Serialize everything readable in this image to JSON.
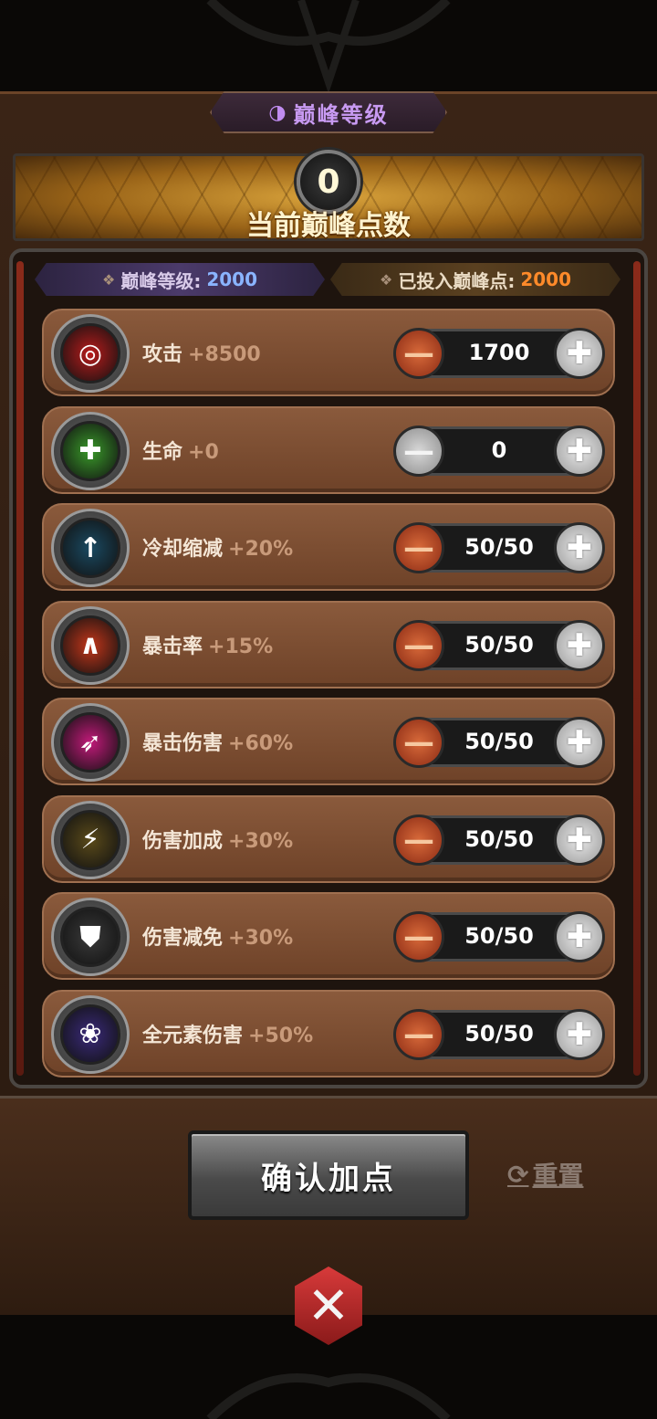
{
  "header": {
    "title": "巅峰等级",
    "points_value": "0",
    "points_label": "当前巅峰点数"
  },
  "summary": {
    "level_label": "巅峰等级:",
    "level_value": "2000",
    "invested_label": "已投入巅峰点:",
    "invested_value": "2000"
  },
  "stats": [
    {
      "name": "攻击",
      "bonus": "+8500",
      "value": "1700",
      "icon": "attack-target-icon",
      "color": "#b81c1c",
      "minus_disabled": false
    },
    {
      "name": "生命",
      "bonus": "+0",
      "value": "0",
      "icon": "health-cross-icon",
      "color": "#3a9a2a",
      "minus_disabled": true
    },
    {
      "name": "冷却缩减",
      "bonus": "+20%",
      "value": "50/50",
      "icon": "cooldown-arrow-icon",
      "color": "#1a4a62",
      "minus_disabled": false
    },
    {
      "name": "暴击率",
      "bonus": "+15%",
      "value": "50/50",
      "icon": "crit-flame-icon",
      "color": "#c2361a",
      "minus_disabled": false
    },
    {
      "name": "暴击伤害",
      "bonus": "+60%",
      "value": "50/50",
      "icon": "crit-damage-arrow-icon",
      "color": "#c21a7a",
      "minus_disabled": false
    },
    {
      "name": "伤害加成",
      "bonus": "+30%",
      "value": "50/50",
      "icon": "damage-bonus-lightning-icon",
      "color": "#5a4a1a",
      "minus_disabled": false
    },
    {
      "name": "伤害减免",
      "bonus": "+30%",
      "value": "50/50",
      "icon": "shield-icon",
      "color": "#3a3a3a",
      "minus_disabled": false
    },
    {
      "name": "全元素伤害",
      "bonus": "+50%",
      "value": "50/50",
      "icon": "element-swirl-icon",
      "color": "#3a2a7a",
      "minus_disabled": false
    }
  ],
  "actions": {
    "confirm_label": "确认加点",
    "reset_label": "重置"
  }
}
